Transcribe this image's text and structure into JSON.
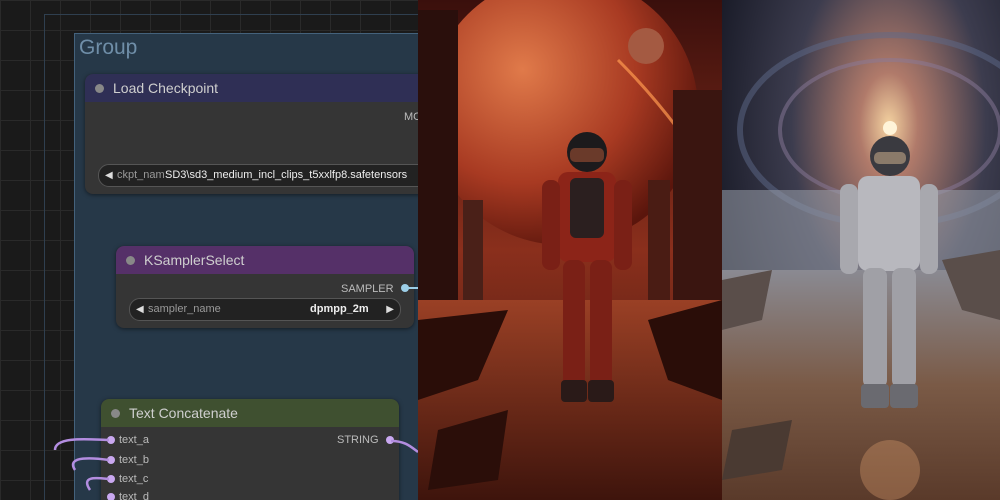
{
  "group": {
    "title": "Group"
  },
  "nodes": {
    "load_checkpoint": {
      "title": "Load Checkpoint",
      "output_label": "MO",
      "widget_label": "ckpt_nam",
      "widget_value": "SD3\\sd3_medium_incl_clips_t5xxlfp8.safetensors"
    },
    "ksampler_select": {
      "title": "KSamplerSelect",
      "output_label": "SAMPLER",
      "widget_label": "sampler_name",
      "widget_value": "dpmpp_2m"
    },
    "text_concatenate": {
      "title": "Text Concatenate",
      "output_label": "STRING",
      "inputs": [
        "text_a",
        "text_b",
        "text_c",
        "text_d"
      ]
    }
  },
  "icons": {
    "arrow_left": "◀",
    "arrow_right": "▶"
  },
  "colors": {
    "load_header": "#2f2f55",
    "ksampler_header": "#553068",
    "textcat_header": "#3f5030",
    "link_purple": "#b38de0",
    "sampler_slot": "#9ccfe8"
  }
}
